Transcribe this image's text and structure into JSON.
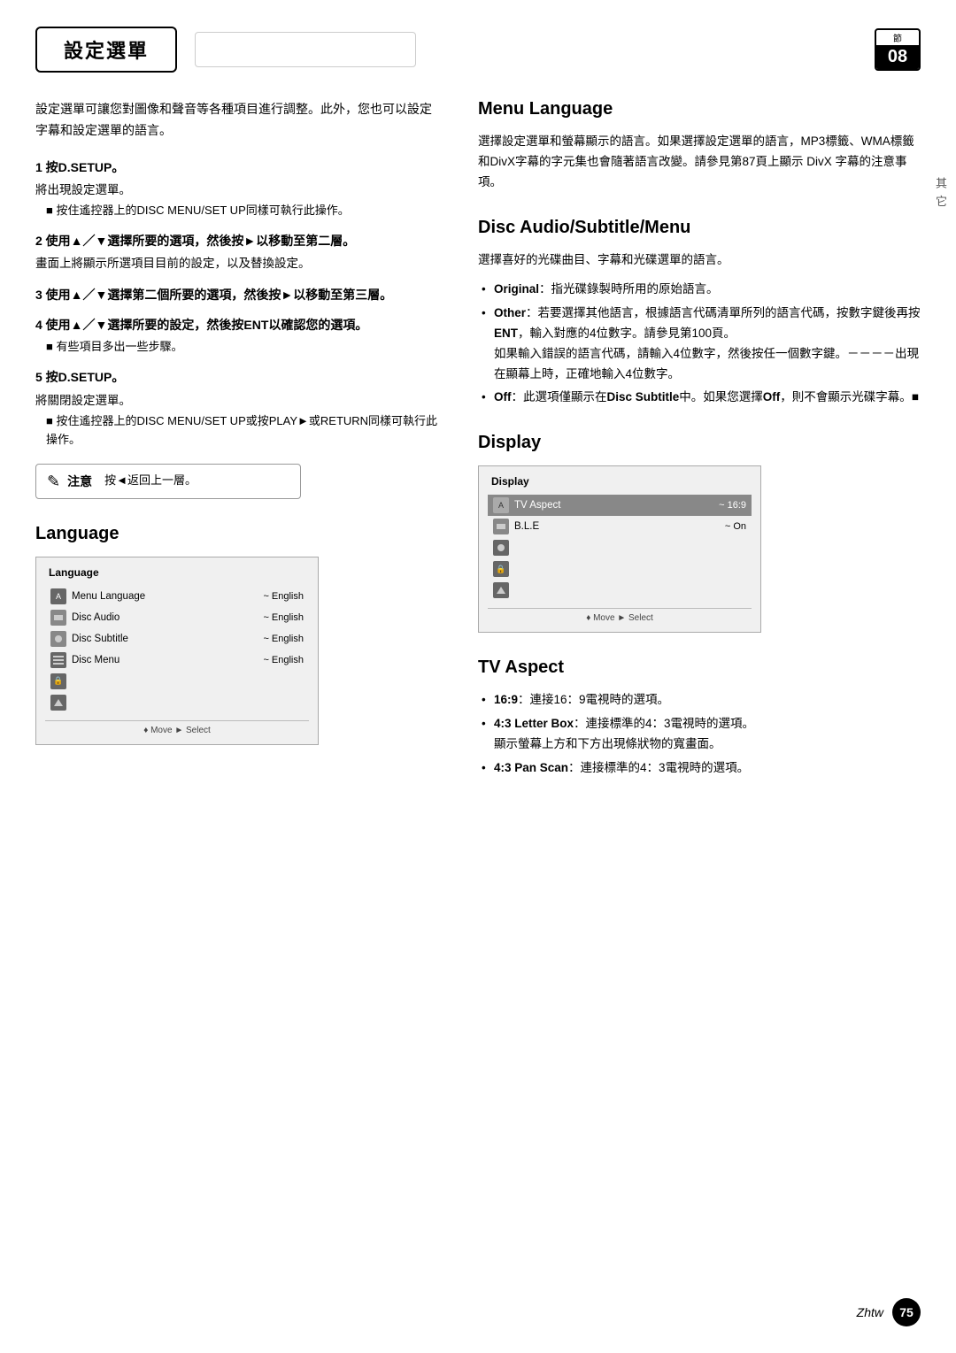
{
  "header": {
    "title": "設定選單",
    "chapter_label": "節",
    "chapter_num": "08"
  },
  "vertical_label": "其 它",
  "left_column": {
    "intro": "設定選單可讓您對圖像和聲音等各種項目進行調整。此外，您也可以設定字幕和設定選單的語言。",
    "steps": [
      {
        "id": "step1",
        "heading": "1  按D.SETUP。",
        "body": "將出現設定選單。",
        "note": "■ 按住遙控器上的DISC MENU/SET UP同樣可執行此操作。"
      },
      {
        "id": "step2",
        "heading": "2  使用▲／▼選擇所要的選項，然後按►以移動至第二層。",
        "body": "畫面上將顯示所選項目目前的設定，以及替換設定。",
        "note": ""
      },
      {
        "id": "step3",
        "heading": "3  使用▲／▼選擇第二個所要的選項，然後按►以移動至第三層。",
        "body": "",
        "note": ""
      },
      {
        "id": "step4",
        "heading": "4  使用▲／▼選擇所要的設定，然後按ENT以確認您的選項。",
        "body": "■ 有些項目多出一些步驟。",
        "note": ""
      },
      {
        "id": "step5",
        "heading": "5  按D.SETUP。",
        "body": "將關閉設定選單。",
        "note": "■ 按住遙控器上的DISC MENU/SET UP或按PLAY►或RETURN同樣可執行此操作。"
      }
    ],
    "note_box": {
      "icon": "✎",
      "title": "注意",
      "body": "按◄返回上一層。"
    },
    "language_section": {
      "heading": "Language",
      "screenshot": {
        "title": "Language",
        "rows": [
          {
            "icon": "A",
            "label": "Menu Language",
            "value": "~ English",
            "selected": false
          },
          {
            "icon": "img",
            "label": "Disc Audio",
            "value": "~ English",
            "selected": false
          },
          {
            "icon": "img2",
            "label": "Disc Subtitle",
            "value": "~ English",
            "selected": false
          },
          {
            "icon": "img3",
            "label": "Disc Menu",
            "value": "~ English",
            "selected": false
          },
          {
            "icon": "lock",
            "label": "",
            "value": "",
            "selected": false
          },
          {
            "icon": "img4",
            "label": "",
            "value": "",
            "selected": false
          }
        ],
        "nav": "♦ Move  ► Select"
      }
    }
  },
  "right_column": {
    "menu_language": {
      "heading": "Menu Language",
      "body": "選擇設定選單和螢幕顯示的語言。如果選擇設定選單的語言，MP3標籤、WMA標籤和DivX字幕的字元集也會隨著語言改變。請參見第87頁上顯示 DivX 字幕的注意事項。"
    },
    "disc_audio_subtitle": {
      "heading": "Disc Audio/Subtitle/Menu",
      "body": "選擇喜好的光碟曲目、字幕和光碟選單的語言。",
      "bullets": [
        {
          "label_bold": "Original",
          "text": "：指光碟錄製時所用的原始語言。"
        },
        {
          "label_bold": "Other",
          "text": "：若要選擇其他語言，根據語言代碼清單所列的語言代碼，按數字鍵後再按ENT，輸入對應的4位數字。請參見第100頁。如果輸入錯誤的語言代碼，請輸入4位數字，然後按任一個數字鍵。－－－－出現在顯幕上時，正確地輸入4位數字。"
        },
        {
          "label_bold": "Off",
          "text": "：此選項僅顯示在Disc Subtitle中。如果您選擇Off，則不會顯示光碟字幕。■"
        }
      ]
    },
    "display": {
      "heading": "Display",
      "screenshot": {
        "title": "Display",
        "rows": [
          {
            "icon": "A",
            "label": "TV Aspect",
            "value": "~ 16:9",
            "selected": true
          },
          {
            "icon": "img",
            "label": "B.L.E",
            "value": "~ On",
            "selected": false
          },
          {
            "icon": "img2",
            "label": "",
            "value": "",
            "selected": false
          },
          {
            "icon": "lock",
            "label": "",
            "value": "",
            "selected": false
          },
          {
            "icon": "img4",
            "label": "",
            "value": "",
            "selected": false
          }
        ],
        "nav": "♦ Move  ► Select"
      }
    },
    "tv_aspect": {
      "heading": "TV Aspect",
      "bullets": [
        {
          "label_bold": "16:9",
          "text": "：連接16：9電視時的選項。"
        },
        {
          "label_bold": "4:3 Letter Box",
          "text": "：連接標準的4：3電視時的選項。顯示螢幕上方和下方出現條狀物的寬畫面。"
        },
        {
          "label_bold": "4:3 Pan Scan",
          "text": "：連接標準的4：3電視時的選項。"
        }
      ]
    }
  },
  "footer": {
    "lang": "Zhtw",
    "page": "75"
  }
}
